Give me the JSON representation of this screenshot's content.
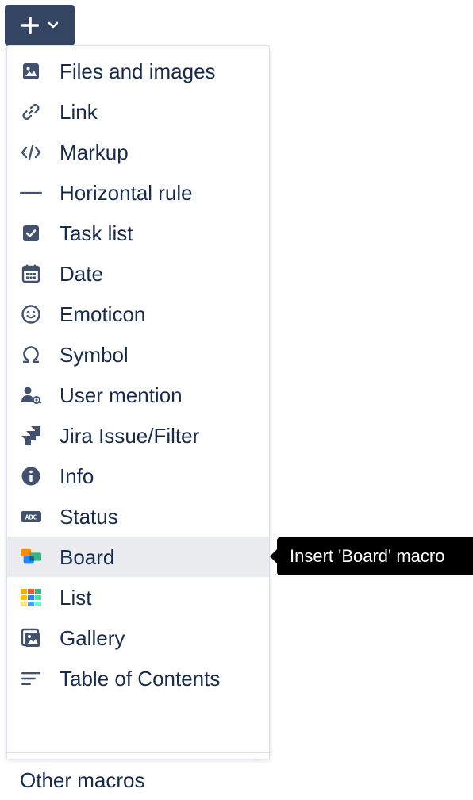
{
  "toolbar": {
    "insert_button_icon": "plus-icon",
    "dropdown_icon": "chevron-down-icon",
    "button_color": "#344563"
  },
  "menu": {
    "items": [
      {
        "label": "Files and images",
        "icon": "image-icon"
      },
      {
        "label": "Link",
        "icon": "link-icon"
      },
      {
        "label": "Markup",
        "icon": "code-icon"
      },
      {
        "label": "Horizontal rule",
        "icon": "horizontal-rule-icon"
      },
      {
        "label": "Task list",
        "icon": "checkbox-icon"
      },
      {
        "label": "Date",
        "icon": "calendar-icon"
      },
      {
        "label": "Emoticon",
        "icon": "smiley-icon"
      },
      {
        "label": "Symbol",
        "icon": "omega-icon"
      },
      {
        "label": "User mention",
        "icon": "user-mention-icon"
      },
      {
        "label": "Jira Issue/Filter",
        "icon": "jira-icon"
      },
      {
        "label": "Info",
        "icon": "info-icon"
      },
      {
        "label": "Status",
        "icon": "status-lozenge-icon"
      },
      {
        "label": "Board",
        "icon": "board-icon",
        "active": true
      },
      {
        "label": "List",
        "icon": "list-grid-icon"
      },
      {
        "label": "Gallery",
        "icon": "gallery-icon"
      },
      {
        "label": "Table of Contents",
        "icon": "toc-icon"
      }
    ],
    "footer_label": "Other macros"
  },
  "tooltip": {
    "text": "Insert 'Board' macro"
  },
  "colors": {
    "text": "#172b4d",
    "active_bg": "#ebecf0",
    "tooltip_bg": "#000000"
  }
}
